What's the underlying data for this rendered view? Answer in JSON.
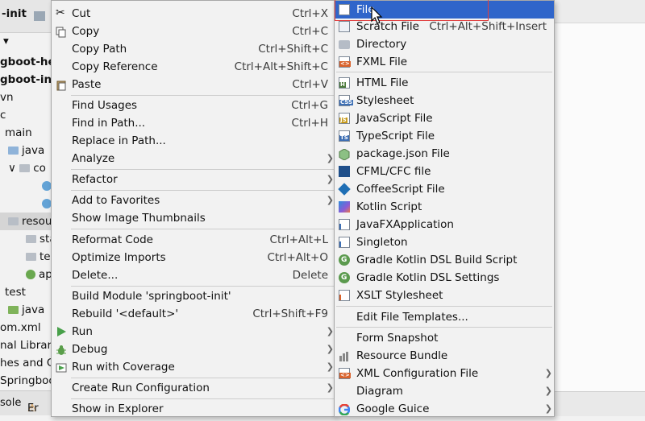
{
  "tree": {
    "tab_text": "-init",
    "rows": [
      {
        "text": "gboot-hel",
        "bold": true
      },
      {
        "text": "gboot-init",
        "bold": true
      },
      {
        "text": "vn",
        "bold": false
      },
      {
        "text": "c",
        "bold": false
      },
      {
        "text": "main",
        "bold": false
      },
      {
        "text": "java",
        "bold": false
      },
      {
        "text": "co",
        "bold": false
      },
      {
        "text": "",
        "bold": false
      },
      {
        "text": "",
        "bold": false
      },
      {
        "text": "resou",
        "bold": false
      },
      {
        "text": "sta",
        "bold": false
      },
      {
        "text": "te",
        "bold": false
      },
      {
        "text": "ap",
        "bold": false
      },
      {
        "text": "test",
        "bold": false
      },
      {
        "text": "java",
        "bold": false
      },
      {
        "text": "om.xml",
        "bold": false
      },
      {
        "text": "nal Librarie",
        "bold": false
      },
      {
        "text": "hes and C",
        "bold": false
      },
      {
        "text": "Springboo",
        "bold": false
      }
    ],
    "bottom_tabs": [
      "sole",
      "Er"
    ]
  },
  "context_menu": {
    "items": [
      {
        "label": "Cut",
        "shortcut": "Ctrl+X",
        "icon": "scissors-icon"
      },
      {
        "label": "Copy",
        "shortcut": "Ctrl+C",
        "icon": "copy-icon"
      },
      {
        "label": "Copy Path",
        "shortcut": "Ctrl+Shift+C"
      },
      {
        "label": "Copy Reference",
        "shortcut": "Ctrl+Alt+Shift+C"
      },
      {
        "label": "Paste",
        "shortcut": "Ctrl+V",
        "icon": "paste-icon"
      },
      {
        "label": "Find Usages",
        "shortcut": "Ctrl+G"
      },
      {
        "label": "Find in Path...",
        "shortcut": "Ctrl+H"
      },
      {
        "label": "Replace in Path..."
      },
      {
        "label": "Analyze",
        "submenu": true
      },
      {
        "label": "Refactor",
        "submenu": true
      },
      {
        "label": "Add to Favorites",
        "submenu": true
      },
      {
        "label": "Show Image Thumbnails"
      },
      {
        "label": "Reformat Code",
        "shortcut": "Ctrl+Alt+L"
      },
      {
        "label": "Optimize Imports",
        "shortcut": "Ctrl+Alt+O"
      },
      {
        "label": "Delete...",
        "shortcut": "Delete"
      },
      {
        "label": "Build Module 'springboot-init'"
      },
      {
        "label": "Rebuild '<default>'",
        "shortcut": "Ctrl+Shift+F9"
      },
      {
        "label": "Run",
        "submenu": true,
        "icon": "run-icon"
      },
      {
        "label": "Debug",
        "submenu": true,
        "icon": "debug-icon"
      },
      {
        "label": "Run with Coverage",
        "submenu": true,
        "icon": "coverage-icon"
      },
      {
        "label": "Create Run Configuration",
        "submenu": true
      },
      {
        "label": "Show in Explorer"
      }
    ]
  },
  "new_menu": {
    "items": [
      {
        "label": "File",
        "icon": "file-icon"
      },
      {
        "label": "Scratch File",
        "shortcut": "Ctrl+Alt+Shift+Insert",
        "icon": "scratch-file-icon"
      },
      {
        "label": "Directory",
        "icon": "folder-icon"
      },
      {
        "label": "FXML File",
        "icon": "fxml-icon",
        "tag": "<>"
      },
      {
        "label": "HTML File",
        "icon": "html-file-icon",
        "tag": "H"
      },
      {
        "label": "Stylesheet",
        "icon": "css-file-icon",
        "tag": "CSS"
      },
      {
        "label": "JavaScript File",
        "icon": "js-file-icon",
        "tag": "JS"
      },
      {
        "label": "TypeScript File",
        "icon": "ts-file-icon",
        "tag": "TS"
      },
      {
        "label": "package.json File",
        "icon": "package-json-icon"
      },
      {
        "label": "CFML/CFC file",
        "icon": "cfml-icon"
      },
      {
        "label": "CoffeeScript File",
        "icon": "coffeescript-icon"
      },
      {
        "label": "Kotlin Script",
        "icon": "kotlin-icon"
      },
      {
        "label": "JavaFXApplication",
        "icon": "javafx-icon"
      },
      {
        "label": "Singleton",
        "icon": "singleton-icon"
      },
      {
        "label": "Gradle Kotlin DSL Build Script",
        "icon": "gradle-icon"
      },
      {
        "label": "Gradle Kotlin DSL Settings",
        "icon": "gradle-icon"
      },
      {
        "label": "XSLT Stylesheet",
        "icon": "xslt-icon"
      },
      {
        "label": "Edit File Templates..."
      },
      {
        "label": "Form Snapshot"
      },
      {
        "label": "Resource Bundle",
        "icon": "resource-bundle-icon"
      },
      {
        "label": "XML Configuration File",
        "submenu": true,
        "icon": "xml-config-icon",
        "tag": "<>"
      },
      {
        "label": "Diagram",
        "submenu": true
      },
      {
        "label": "Google Guice",
        "submenu": true,
        "icon": "google-icon"
      }
    ]
  },
  "colors": {
    "highlight": "#2f65ca",
    "menu_bg": "#f2f2f2",
    "red_box": "#e04040"
  }
}
